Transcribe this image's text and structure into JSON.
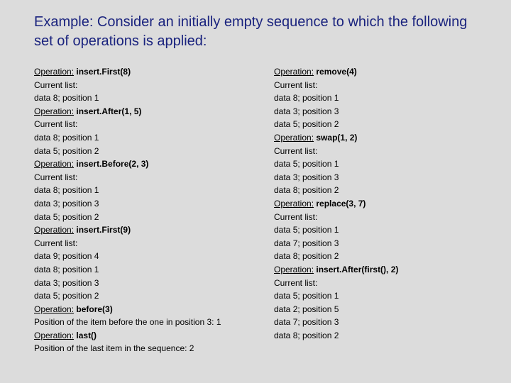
{
  "title": "Example: Consider an initially empty sequence to which the following set of operations is applied:",
  "left": [
    {
      "type": "op",
      "label": "Operation:",
      "value": "insert.First(8)"
    },
    {
      "type": "plain",
      "text": "Current list:"
    },
    {
      "type": "plain",
      "text": "data 8; position 1"
    },
    {
      "type": "op",
      "label": "Operation:",
      "value": "insert.After(1, 5)"
    },
    {
      "type": "plain",
      "text": "Current list:"
    },
    {
      "type": "plain",
      "text": "data 8; position 1"
    },
    {
      "type": "plain",
      "text": "data 5; position 2"
    },
    {
      "type": "op",
      "label": "Operation:",
      "value": "insert.Before(2, 3)"
    },
    {
      "type": "plain",
      "text": "Current list:"
    },
    {
      "type": "plain",
      "text": "data 8; position 1"
    },
    {
      "type": "plain",
      "text": "data 3; position 3"
    },
    {
      "type": "plain",
      "text": "data 5; position 2"
    },
    {
      "type": "op",
      "label": "Operation:",
      "value": "insert.First(9)"
    },
    {
      "type": "plain",
      "text": "Current list:"
    },
    {
      "type": "plain",
      "text": "data 9; position 4"
    },
    {
      "type": "plain",
      "text": "data 8; position 1"
    },
    {
      "type": "plain",
      "text": "data 3; position 3"
    },
    {
      "type": "plain",
      "text": "data 5; position 2"
    },
    {
      "type": "op",
      "label": "Operation:",
      "value": "before(3)"
    },
    {
      "type": "plain",
      "text": "Position of the item before the one in position 3: 1"
    },
    {
      "type": "op",
      "label": "Operation:",
      "value": "last()"
    },
    {
      "type": "plain",
      "text": "Position of the last item in the sequence: 2"
    }
  ],
  "right": [
    {
      "type": "op",
      "label": "Operation:",
      "value": "remove(4)"
    },
    {
      "type": "plain",
      "text": "Current list:"
    },
    {
      "type": "plain",
      "text": "data 8; position 1"
    },
    {
      "type": "plain",
      "text": "data 3; position 3"
    },
    {
      "type": "plain",
      "text": "data 5; position 2"
    },
    {
      "type": "op",
      "label": "Operation:",
      "value": "swap(1, 2)"
    },
    {
      "type": "plain",
      "text": "Current list:"
    },
    {
      "type": "plain",
      "text": "data 5; position 1"
    },
    {
      "type": "plain",
      "text": "data 3; position 3"
    },
    {
      "type": "plain",
      "text": "data 8; position 2"
    },
    {
      "type": "op",
      "label": "Operation:",
      "value": "replace(3, 7)"
    },
    {
      "type": "plain",
      "text": "Current list:"
    },
    {
      "type": "plain",
      "text": "data 5; position 1"
    },
    {
      "type": "plain",
      "text": "data 7; position 3"
    },
    {
      "type": "plain",
      "text": "data 8; position 2"
    },
    {
      "type": "op",
      "label": "Operation:",
      "value": "insert.After(first(), 2)"
    },
    {
      "type": "plain",
      "text": "Current list:"
    },
    {
      "type": "plain",
      "text": "data 5; position 1"
    },
    {
      "type": "plain",
      "text": "data 2; position 5"
    },
    {
      "type": "plain",
      "text": "data 7; position 3"
    },
    {
      "type": "plain",
      "text": "data 8; position 2"
    }
  ]
}
